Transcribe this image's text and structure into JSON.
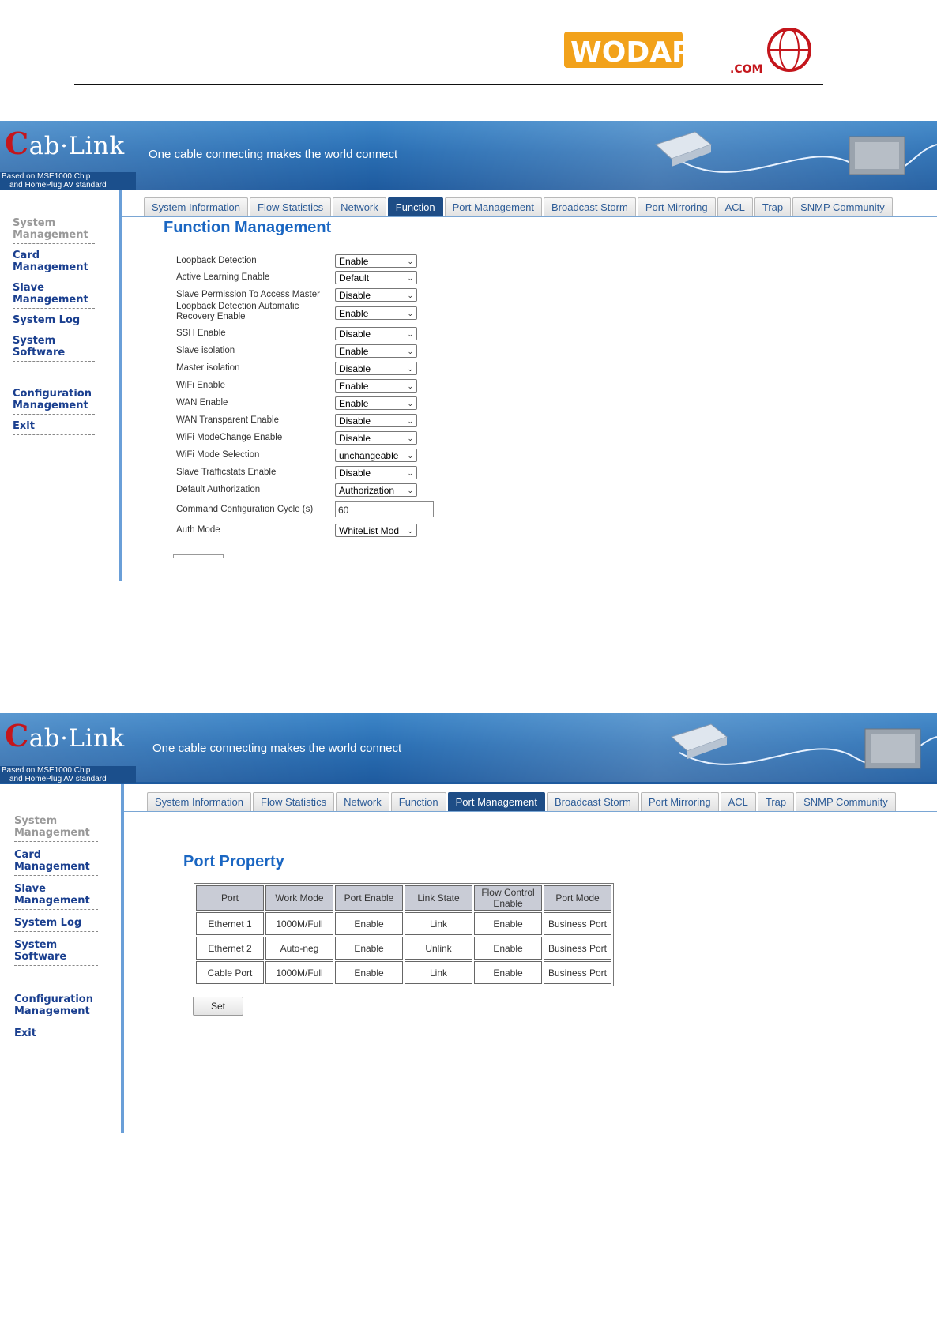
{
  "doc": {
    "logo_text": "WODAPLUG",
    "logo_sub": ".COM"
  },
  "panel1": {
    "banner": {
      "brand_c": "C",
      "brand_rest": "ab·Link",
      "chip_line1": "Based on MSE1000 Chip",
      "chip_line2": "and HomePlug AV standard",
      "tagline": "One cable connecting makes the world connect"
    },
    "sidebar": [
      "System Management",
      "Card Management",
      "Slave Management",
      "System Log",
      "System Software",
      "Configuration Management",
      "Exit"
    ],
    "tabs": [
      "System Information",
      "Flow Statistics",
      "Network",
      "Function",
      "Port Management",
      "Broadcast Storm",
      "Port Mirroring",
      "ACL",
      "Trap",
      "SNMP Community"
    ],
    "active_tab": "Function",
    "title": "Function Management",
    "fields": [
      {
        "label": "Loopback Detection",
        "value": "Enable"
      },
      {
        "label": "Active Learning Enable",
        "value": "Default"
      },
      {
        "label": "Slave Permission To Access Master",
        "value": "Disable"
      },
      {
        "label": "Loopback Detection Automatic Recovery Enable",
        "value": "Enable"
      },
      {
        "label": "SSH Enable",
        "value": "Disable"
      },
      {
        "label": "Slave isolation",
        "value": "Enable"
      },
      {
        "label": "Master isolation",
        "value": "Disable"
      },
      {
        "label": "WiFi Enable",
        "value": "Enable"
      },
      {
        "label": "WAN Enable",
        "value": "Enable"
      },
      {
        "label": "WAN Transparent Enable",
        "value": "Disable"
      },
      {
        "label": "WiFi ModeChange Enable",
        "value": "Disable"
      },
      {
        "label": "WiFi Mode Selection",
        "value": "unchangeable"
      },
      {
        "label": "Slave Trafficstats Enable",
        "value": "Disable"
      },
      {
        "label": "Default Authorization",
        "value": "Authorization"
      },
      {
        "label": "Command Configuration Cycle (s)",
        "value": "60"
      },
      {
        "label": "Auth Mode",
        "value": "WhiteList Mod"
      }
    ]
  },
  "panel2": {
    "sidebar": [
      "System Management",
      "Card Management",
      "Slave Management",
      "System Log",
      "System Software",
      "Configuration Management",
      "Exit"
    ],
    "tabs": [
      "System Information",
      "Flow Statistics",
      "Network",
      "Function",
      "Port Management",
      "Broadcast Storm",
      "Port Mirroring",
      "ACL",
      "Trap",
      "SNMP Community"
    ],
    "active_tab": "Port Management",
    "title": "Port Property",
    "table": {
      "headers": [
        "Port",
        "Work Mode",
        "Port Enable",
        "Link State",
        "Flow Control Enable",
        "Port Mode"
      ],
      "rows": [
        [
          "Ethernet 1",
          "1000M/Full",
          "Enable",
          "Link",
          "Enable",
          "Business Port"
        ],
        [
          "Ethernet 2",
          "Auto-neg",
          "Enable",
          "Unlink",
          "Enable",
          "Business Port"
        ],
        [
          "Cable Port",
          "1000M/Full",
          "Enable",
          "Link",
          "Enable",
          "Business Port"
        ]
      ]
    },
    "set_label": "Set"
  }
}
